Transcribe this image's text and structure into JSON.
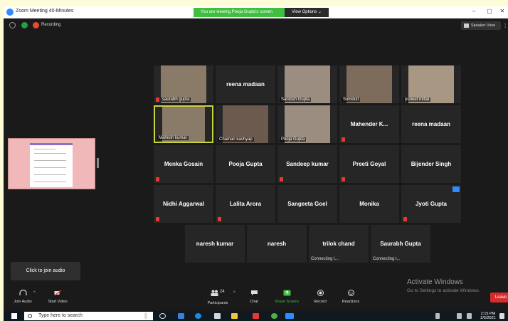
{
  "window": {
    "title": "Zoom Meeting 40-Minutes",
    "share_banner": "You are viewing Pooja Gupta's screen",
    "view_options": "View Options ⌄",
    "minimize": "–",
    "maximize": "▢",
    "close": "✕"
  },
  "topbar": {
    "recording": "Recording",
    "speaker_view": "Speaker View"
  },
  "participants": {
    "rows": [
      [
        {
          "label": "saurabh gupta",
          "video": true,
          "muted": true
        },
        {
          "label": "reena madaan",
          "video": false,
          "muted": false
        },
        {
          "label": "Santosh Gupta",
          "video": true,
          "muted": false
        },
        {
          "label": "Somdutt",
          "video": true,
          "muted": false
        },
        {
          "label": "puneet mittal",
          "video": true,
          "muted": false
        }
      ],
      [
        {
          "label": "Mahesh kumar",
          "video": true,
          "muted": false,
          "active": true
        },
        {
          "label": "Chaman kashyap",
          "video": true,
          "muted": false
        },
        {
          "label": "Pooja Gupta",
          "video": true,
          "muted": false
        },
        {
          "label": "Mahender K...",
          "video": false,
          "muted": true
        },
        {
          "label": "reena madaan",
          "video": false,
          "muted": false
        }
      ],
      [
        {
          "label": "Menka Gosain",
          "video": false,
          "muted": true
        },
        {
          "label": "Pooja Gupta",
          "video": false,
          "muted": false
        },
        {
          "label": "Sandeep kumar",
          "video": false,
          "muted": true
        },
        {
          "label": "Preeti Goyal",
          "video": false,
          "muted": true
        },
        {
          "label": "Bijender Singh",
          "video": false,
          "muted": false
        }
      ],
      [
        {
          "label": "Nidhi Aggarwal",
          "video": false,
          "muted": true
        },
        {
          "label": "Lalita Arora",
          "video": false,
          "muted": true
        },
        {
          "label": "Sangeeta Goel",
          "video": false,
          "muted": false
        },
        {
          "label": "Monika",
          "video": false,
          "muted": false
        },
        {
          "label": "Jyoti Gupta",
          "video": false,
          "muted": true,
          "more": true
        }
      ],
      [
        {
          "label": "naresh kumar",
          "video": false
        },
        {
          "label": "naresh",
          "video": false
        },
        {
          "label": "trilok chand",
          "video": false,
          "status": "Connecting t..."
        },
        {
          "label": "Saurabh Gupta",
          "video": false,
          "status": "Connecting t..."
        }
      ]
    ]
  },
  "tooltip": "Click to join audio",
  "watermark": {
    "line1": "Activate Windows",
    "line2": "Go to Settings to activate Windows."
  },
  "toolbar": {
    "join_audio": "Join Audio",
    "start_video": "Start Video",
    "participants": "Participants",
    "participants_count": "24",
    "chat": "Chat",
    "share_screen": "Share Screen",
    "record": "Record",
    "reactions": "Reactions",
    "leave": "Leave"
  },
  "taskbar": {
    "search_placeholder": "Type here to search",
    "time": "2:15 PM",
    "date": "2/5/2021"
  },
  "colors": {
    "accent_green": "#3fbf3f",
    "active_speaker": "#c8d43c",
    "leave_red": "#d82c2c",
    "zoom_blue": "#2d8cff"
  }
}
